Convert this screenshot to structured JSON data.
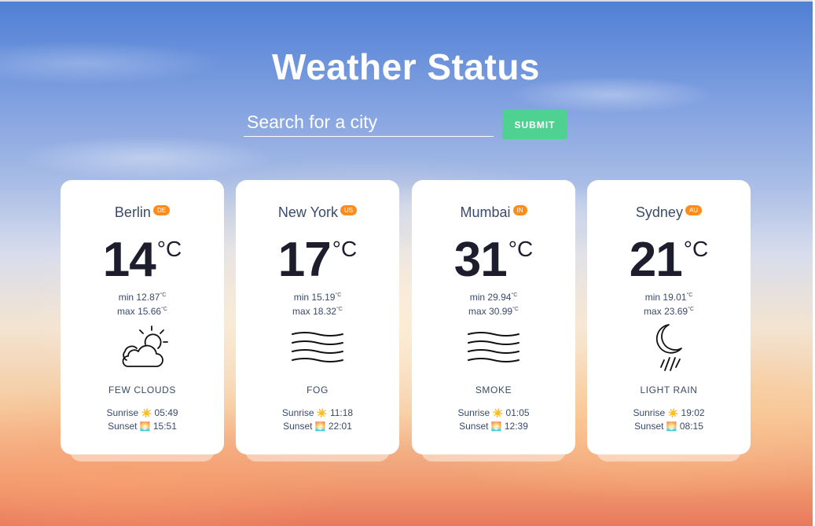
{
  "header": {
    "title": "Weather Status"
  },
  "search": {
    "placeholder": "Search for a city",
    "submit_label": "SUBMIT"
  },
  "unit": "°C",
  "labels": {
    "min": "min",
    "max": "max",
    "sunrise": "Sunrise",
    "sunset": "Sunset",
    "sunrise_icon": "☀️",
    "sunset_icon": "🌅"
  },
  "cards": [
    {
      "city": "Berlin",
      "country": "DE",
      "temp": "14",
      "min": "12.87",
      "max": "15.66",
      "icon": "few-clouds-icon",
      "description": "FEW CLOUDS",
      "sunrise": "05:49",
      "sunset": "15:51"
    },
    {
      "city": "New York",
      "country": "US",
      "temp": "17",
      "min": "15.19",
      "max": "18.32",
      "icon": "fog-icon",
      "description": "FOG",
      "sunrise": "11:18",
      "sunset": "22:01"
    },
    {
      "city": "Mumbai",
      "country": "IN",
      "temp": "31",
      "min": "29.94",
      "max": "30.99",
      "icon": "smoke-icon",
      "description": "SMOKE",
      "sunrise": "01:05",
      "sunset": "12:39"
    },
    {
      "city": "Sydney",
      "country": "AU",
      "temp": "21",
      "min": "19.01",
      "max": "23.69",
      "icon": "night-rain-icon",
      "description": "LIGHT RAIN",
      "sunrise": "19:02",
      "sunset": "08:15"
    }
  ],
  "colors": {
    "accent": "#4fd192",
    "badge": "#ff8c1a",
    "card": "#ffffff"
  }
}
